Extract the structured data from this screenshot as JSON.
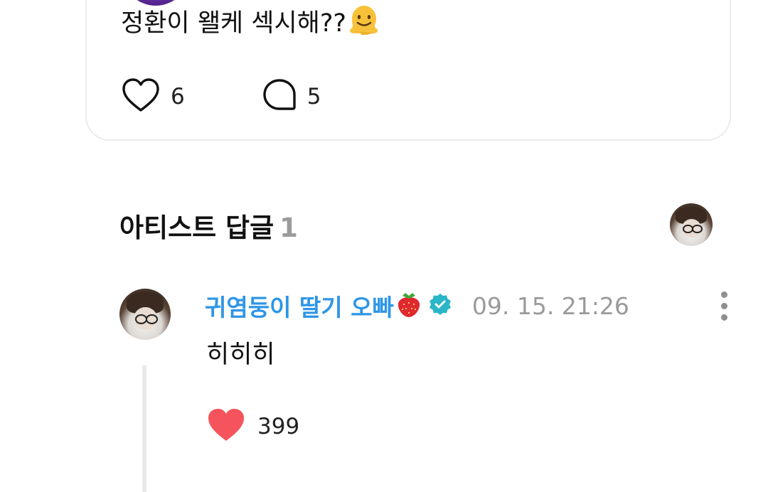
{
  "post": {
    "text": "정환이 왤케 섹시해??",
    "emoji": "melting-face",
    "likes": "6",
    "comments": "5"
  },
  "artist_replies": {
    "title": "아티스트 답글",
    "count": "1"
  },
  "reply": {
    "author": "귀염둥이 딸기 오빠",
    "author_emoji": "strawberry",
    "verified": true,
    "timestamp": "09. 15. 21:26",
    "text": "히히히",
    "likes": "399",
    "liked": true
  },
  "colors": {
    "author_name": "#2f96e6",
    "verified_badge": "#2ab6c8",
    "like_heart": "#f5545c",
    "muted_text": "#9a9a9a",
    "card_border": "#ececec"
  }
}
